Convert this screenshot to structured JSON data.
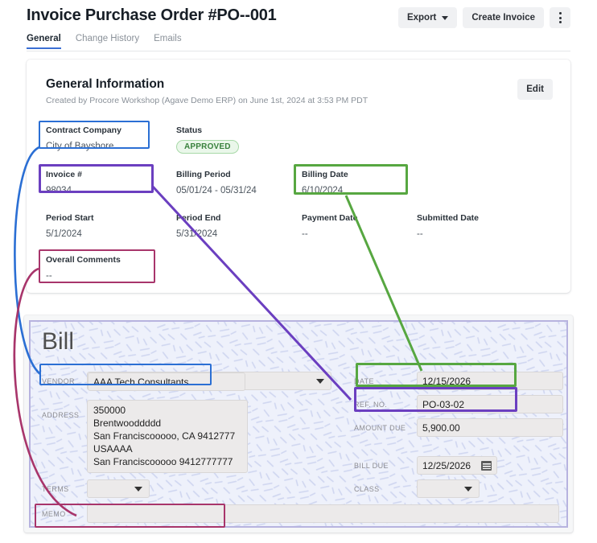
{
  "header": {
    "title": "Invoice Purchase Order #PO--001",
    "export_label": "Export",
    "create_invoice_label": "Create Invoice",
    "tabs": [
      {
        "label": "General",
        "active": true
      },
      {
        "label": "Change History",
        "active": false
      },
      {
        "label": "Emails",
        "active": false
      }
    ]
  },
  "general_information": {
    "title": "General Information",
    "subtitle": "Created by Procore Workshop (Agave Demo ERP) on June 1st, 2024 at 3:53 PM PDT",
    "edit_label": "Edit",
    "fields": {
      "contract_company": {
        "label": "Contract Company",
        "value": "City of Bayshore"
      },
      "status": {
        "label": "Status",
        "value": "APPROVED"
      },
      "invoice_number": {
        "label": "Invoice #",
        "value": "98034"
      },
      "billing_period": {
        "label": "Billing Period",
        "value": "05/01/24 - 05/31/24"
      },
      "billing_date": {
        "label": "Billing Date",
        "value": "6/10/2024"
      },
      "period_start": {
        "label": "Period Start",
        "value": "5/1/2024"
      },
      "period_end": {
        "label": "Period End",
        "value": "5/31/2024"
      },
      "payment_date": {
        "label": "Payment Date",
        "value": "--"
      },
      "submitted_date": {
        "label": "Submitted Date",
        "value": "--"
      },
      "overall_comments": {
        "label": "Overall Comments",
        "value": "--"
      }
    }
  },
  "bill": {
    "title": "Bill",
    "fields": {
      "vendor": {
        "label": "VENDOR",
        "value": "AAA Tech Consultants"
      },
      "address": {
        "label": "ADDRESS",
        "lines": [
          "350000",
          "Brentwooddddd",
          "San Franciscooooo, CA 9412777",
          "USAAAA",
          "San Franciscooooo 9412777777"
        ]
      },
      "terms": {
        "label": "TERMS",
        "value": ""
      },
      "memo": {
        "label": "MEMO",
        "value": ""
      },
      "date": {
        "label": "DATE",
        "value": "12/15/2026"
      },
      "ref_no": {
        "label": "REF. NO.",
        "value": "PO-03-02"
      },
      "amount_due": {
        "label": "AMOUNT DUE",
        "value": "5,900.00"
      },
      "bill_due": {
        "label": "BILL DUE",
        "value": "12/25/2026"
      },
      "class": {
        "label": "CLASS",
        "value": ""
      }
    }
  },
  "annotations": {
    "colors": {
      "blue": "#2b6fd4",
      "purple": "#6b3fc0",
      "green": "#57a741",
      "magenta": "#a8356b"
    },
    "links": [
      {
        "name": "contract-company-to-vendor",
        "color": "blue",
        "from": "contract_company",
        "to": "vendor"
      },
      {
        "name": "invoice-number-to-ref-no",
        "color": "purple",
        "from": "invoice_number",
        "to": "ref_no"
      },
      {
        "name": "billing-date-to-date",
        "color": "green",
        "from": "billing_date",
        "to": "date"
      },
      {
        "name": "overall-comments-to-memo",
        "color": "magenta",
        "from": "overall_comments",
        "to": "memo"
      }
    ]
  }
}
